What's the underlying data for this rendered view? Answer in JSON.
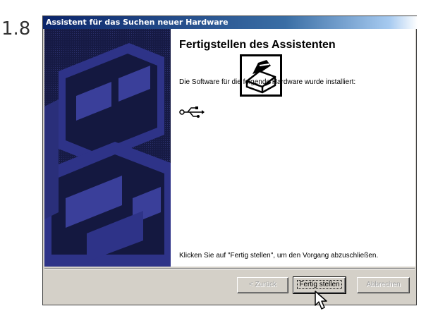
{
  "step_number": "1.8",
  "window": {
    "title": "Assistent für das Suchen neuer Hardware"
  },
  "content": {
    "heading": "Fertigstellen des Assistenten",
    "description": "Die Software für die folgende Hardware wurde installiert:",
    "device_icon": "usb-icon",
    "finish_hint": "Klicken Sie auf \"Fertig stellen\", um den Vorgang abzuschließen."
  },
  "buttons": {
    "back_label": "< Zurück",
    "finish_label": "Fertig stellen",
    "cancel_label": "Abbrechen"
  },
  "colors": {
    "titlebar": "#0a246a",
    "side_panel": "#141840",
    "side_panel_art": "#3a3f9a",
    "dialog_bg": "#d4d0c8"
  }
}
